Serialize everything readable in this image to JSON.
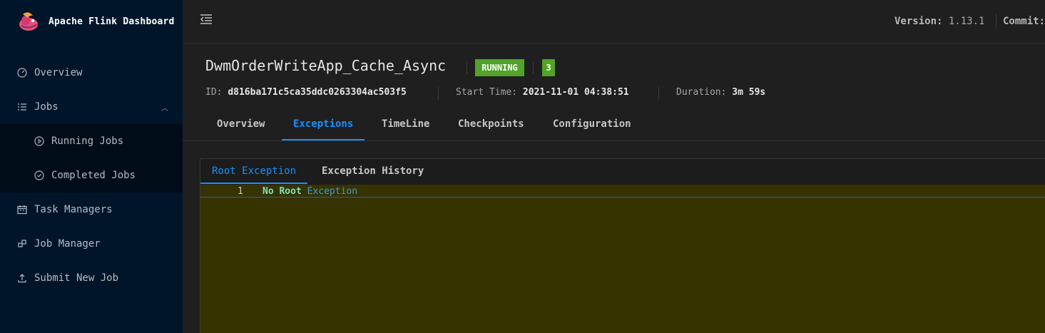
{
  "app": {
    "title": "Apache Flink Dashboard"
  },
  "sidebar": {
    "items": [
      {
        "label": "Overview",
        "icon": "dashboard-icon"
      },
      {
        "label": "Jobs",
        "icon": "list-icon",
        "expanded": true
      },
      {
        "label": "Running Jobs",
        "icon": "play-circle-icon"
      },
      {
        "label": "Completed Jobs",
        "icon": "check-circle-icon"
      },
      {
        "label": "Task Managers",
        "icon": "schedule-icon"
      },
      {
        "label": "Job Manager",
        "icon": "build-icon"
      },
      {
        "label": "Submit New Job",
        "icon": "upload-icon"
      }
    ]
  },
  "header": {
    "version_label": "Version:",
    "version_value": "1.13.1",
    "commit_label": "Commit:"
  },
  "job": {
    "name": "DwmOrderWriteApp_Cache_Async",
    "status": "RUNNING",
    "count": "3",
    "id_label": "ID:",
    "id": "d816ba171c5ca35ddc0263304ac503f5",
    "start_label": "Start Time:",
    "start_time": "2021-11-01 04:38:51",
    "duration_label": "Duration:",
    "duration": "3m 59s",
    "status_color": "#52a327"
  },
  "tabs": [
    "Overview",
    "Exceptions",
    "TimeLine",
    "Checkpoints",
    "Configuration"
  ],
  "active_tab": "Exceptions",
  "subtabs": [
    "Root Exception",
    "Exception History"
  ],
  "editor": {
    "line_number": "1",
    "keyword_text": "No Root",
    "rest_text": "Exception"
  }
}
